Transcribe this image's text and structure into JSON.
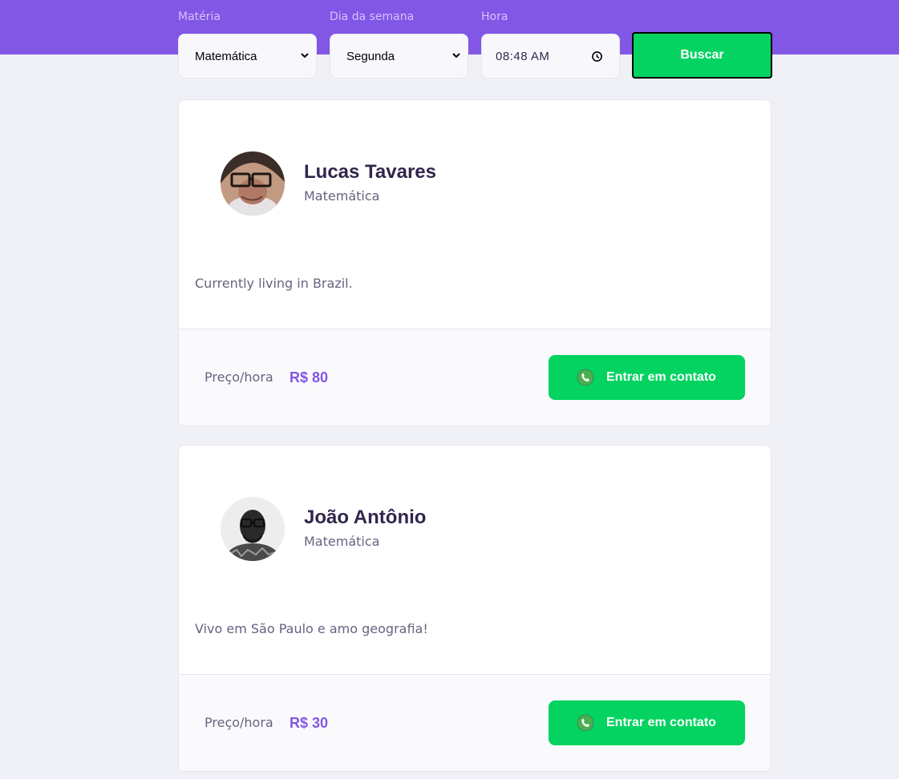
{
  "filters": {
    "subject": {
      "label": "Matéria",
      "value": "Matemática"
    },
    "weekday": {
      "label": "Dia da semana",
      "value": "Segunda"
    },
    "time": {
      "label": "Hora",
      "value": "08:48 AM"
    },
    "search_label": "Buscar"
  },
  "teachers": [
    {
      "name": "Lucas Tavares",
      "subject": "Matemática",
      "bio": "Currently living in Brazil.",
      "price_label": "Preço/hora",
      "price": "R$ 80",
      "contact_label": "Entrar em contato"
    },
    {
      "name": "João Antônio",
      "subject": "Matemática",
      "bio": "Vivo em São Paulo e amo geografia!",
      "price_label": "Preço/hora",
      "price": "R$ 30",
      "contact_label": "Entrar em contato"
    }
  ],
  "colors": {
    "primary": "#8257E5",
    "secondary": "#04D361",
    "background": "#F0F0F7",
    "title_text": "#32264D",
    "body_text": "#6A6180"
  },
  "icons": {
    "select_arrow": "chevron-down-icon",
    "time": "clock-icon",
    "contact": "whatsapp-icon"
  }
}
